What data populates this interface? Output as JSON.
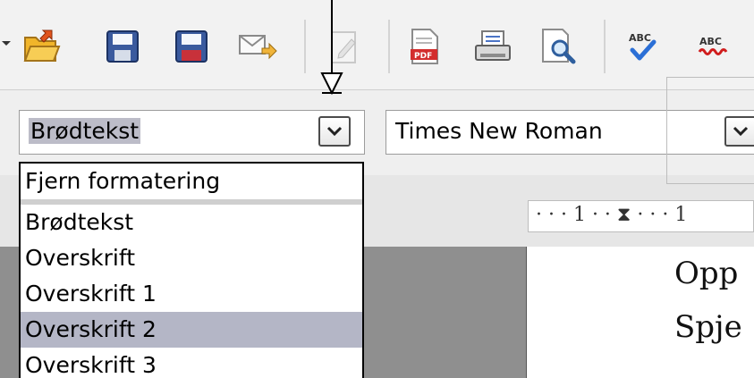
{
  "toolbar": {
    "buttons": [
      {
        "name": "open-folder-icon"
      },
      {
        "name": "save-icon"
      },
      {
        "name": "save-as-icon"
      },
      {
        "name": "email-document-icon"
      },
      {
        "name": "edit-file-icon"
      },
      {
        "name": "export-pdf-icon"
      },
      {
        "name": "print-icon"
      },
      {
        "name": "print-preview-icon"
      },
      {
        "name": "spellcheck-icon"
      },
      {
        "name": "autospellcheck-icon"
      }
    ]
  },
  "formatting": {
    "paragraph_style": "Brødtekst",
    "font_name": "Times New Roman"
  },
  "style_list": {
    "items": [
      "Fjern formatering",
      "Brødtekst",
      "Overskrift",
      "Overskrift 1",
      "Overskrift 2",
      "Overskrift 3"
    ],
    "selected_index": 4
  },
  "ruler": {
    "text": "· · · 1 · · ⧗ · · · 1"
  },
  "document": {
    "line1": "Opp",
    "line2": "Spje"
  },
  "colors": {
    "selection": "#b4b6c6",
    "toolbar_bg": "#f2f2f2",
    "folder_yellow": "#f1b52a",
    "save_blue": "#3a5a9e",
    "save_red": "#c8313a",
    "check_blue": "#2b6fd6",
    "underline_red": "#d01d1d"
  }
}
